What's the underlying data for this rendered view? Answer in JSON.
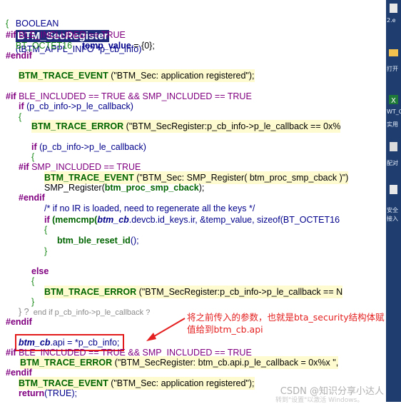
{
  "code": {
    "func_ret": "BOOLEAN",
    "func_name": "BTM_SecRegister",
    "func_params": "(tBTM_APPL_INFO *p_cb_info)",
    "brace_open": "{",
    "l3_kw": "#if",
    "l3_rest": " BLE_INCLUDED == TRUE",
    "l4_type": "    BT_OCTET16",
    "l4_var": "temp_value",
    "l4_init": " = {0};",
    "l5": "#endif",
    "l7_fn": "BTM_TRACE_EVENT",
    "l7_arg": " (\"BTM_Sec: application registered\");",
    "l9_kw": "#if",
    "l9_rest": " BLE_INCLUDED == TRUE && SMP_INCLUDED == TRUE",
    "l10_kw": "if",
    "l10_rest": " (p_cb_info->p_le_callback)",
    "l11": "{",
    "l12_fn": "BTM_TRACE_ERROR",
    "l12_arg": " (\"BTM_SecRegister:p_cb_info->p_le_callback == 0x%",
    "l14_kw": "if",
    "l14_rest": " (p_cb_info->p_le_callback)",
    "l15": "{",
    "l16_kw": "#if",
    "l16_rest": " SMP_INCLUDED == TRUE",
    "l17_fn": "BTM_TRACE_EVENT",
    "l17_arg": " (\"BTM_Sec: SMP_Register( btm_proc_smp_cback )\")",
    "l18_a": "SMP_Register(",
    "l18_b": "btm_proc_smp_cback",
    "l18_c": ");",
    "l19": "#endif",
    "l20": "/* if no IR is loaded, need to regenerate all the keys */",
    "l21_kw": "if",
    "l21_fn": "(memcmp(",
    "l21_ptr": "btm_cb",
    "l21_rest": ".devcb.id_keys.ir, &temp_value, sizeof(BT_OCTET16",
    "l22": "{",
    "l23_fn": "btm_ble_reset_id",
    "l23_rest": "();",
    "l24": "}",
    "l25": "else",
    "l26": "{",
    "l27_fn": "BTM_TRACE_ERROR",
    "l27_arg": " (\"BTM_SecRegister:p_cb_info->p_le_callback == N",
    "l28": "}",
    "l29_a": "} ?",
    "l29_b": "  end if p_cb_info->p_le_callback ?",
    "l30": "#endif",
    "l31_ptr": "btm_cb",
    "l31_rest": ".api = *p_cb_info;",
    "l32_kw": "#if",
    "l32_rest": " BLE_INCLUDED == TRUE && SMP_INCLUDED == TRUE",
    "l33_fn": "BTM_TRACE_ERROR",
    "l33_arg": " (\"BTM_SecRegister: btm_cb.api.p_le_callback = 0x%x \",",
    "l34": "#endif",
    "l35_fn": "BTM_TRACE_EVENT",
    "l35_arg": " (\"BTM_Sec: application registered\");",
    "l36_kw": "return",
    "l36_rest": "(TRUE);"
  },
  "annotation": {
    "line1": "将之前传入的参数，也就是bta_security结构体赋",
    "line2": "值给到btm_cb.api"
  },
  "watermark": {
    "csdn": "CSDN @知识分享小达人",
    "activate": "转到\"设置\"以激活 Windows。"
  },
  "sidebar": {
    "item1": "2.e",
    "item2": "打开",
    "item3": "WT_O",
    "item4": "实用",
    "item5": "配对",
    "item6": "安全",
    "item7": "接入"
  },
  "colors": {
    "keyword": "#800080",
    "function": "#006400",
    "pointer": "#00008b",
    "highlight_bg": "#fffbd0",
    "selection_bg": "#1f2a7a",
    "annotation": "#e42020"
  }
}
